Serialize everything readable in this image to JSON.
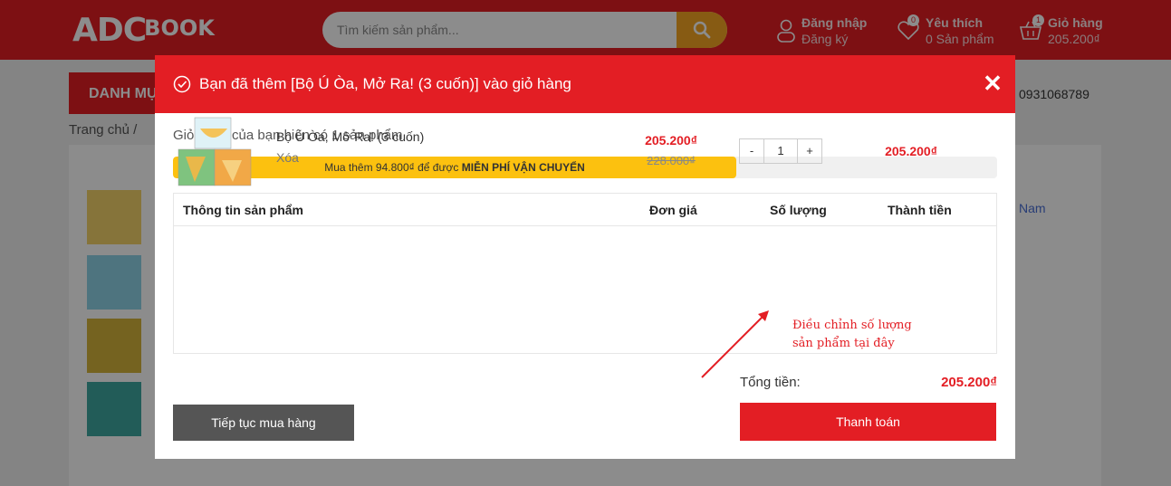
{
  "header": {
    "logo_main": "ADC",
    "logo_sub": "BOOK",
    "search_placeholder": "Tìm kiếm sản phẩm...",
    "login": {
      "line1": "Đăng nhập",
      "line2": "Đăng ký"
    },
    "wishlist": {
      "line1": "Yêu thích",
      "line2": "0 Sản phẩm",
      "badge": "0"
    },
    "cart": {
      "line1": "Giỏ hàng",
      "line2": "205.200₫",
      "badge": "1"
    }
  },
  "background_page": {
    "nav_button": "DANH MỤ",
    "hotline": "0931068789",
    "breadcrumb": "Trang chủ  /",
    "side_link": "Nam"
  },
  "modal": {
    "success_message": "Bạn đã thêm [Bộ Ú Òa, Mở Ra! (3 cuốn)] vào giỏ hàng",
    "close_label": "✕",
    "cart_count_text": "Giỏ hàng của bạn hiện có 1 sản phẩm",
    "shipping": {
      "text_prefix": "Mua thêm 94.800₫ để được",
      "text_strong": "MIỄN PHÍ VẬN CHUYỂN",
      "progress": 0.684
    },
    "table_headers": {
      "product": "Thông tin sản phẩm",
      "price": "Đơn giá",
      "quantity": "Số lượng",
      "total": "Thành tiền"
    },
    "item": {
      "name": "Bộ Ú Òa, Mở Ra! (3 cuốn)",
      "remove": "Xóa",
      "price": "205.200₫",
      "old_price": "228.000₫",
      "qty_minus": "-",
      "qty_value": "1",
      "qty_plus": "+",
      "line_total": "205.200₫"
    },
    "annotation": {
      "line1": "Điều chỉnh số lượng",
      "line2": "sản phẩm tại đây"
    },
    "total_label": "Tổng tiền:",
    "total_value": "205.200₫",
    "continue_button": "Tiếp tục mua hàng",
    "checkout_button": "Thanh toán"
  },
  "colors": {
    "brand_red": "#e31e24",
    "search_button": "#f6a723",
    "progress_yellow": "#fcc10f"
  }
}
